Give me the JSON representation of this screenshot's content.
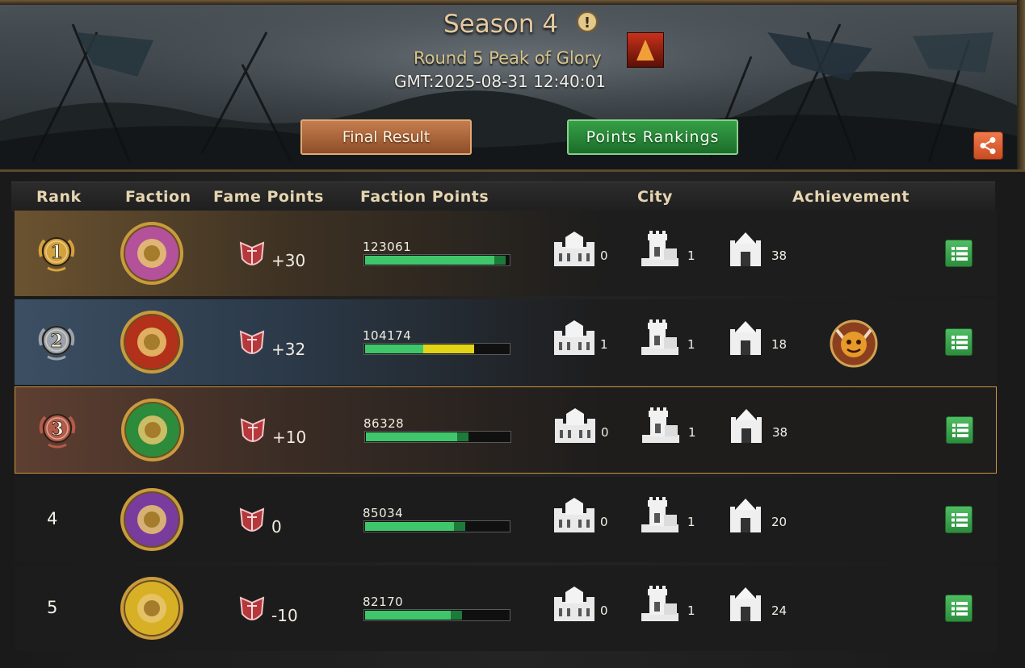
{
  "header": {
    "season_title": "Season 4",
    "round_title": "Round 5 Peak of Glory",
    "time_label": "GMT:2025-08-31 12:40:01",
    "tabs": [
      {
        "label": "Final Result",
        "color": "#a95f34"
      },
      {
        "label": "Points Rankings",
        "color": "#2a8a3a",
        "selected": true
      }
    ]
  },
  "table": {
    "columns": [
      "Rank",
      "Faction",
      "Fame Points",
      "Faction Points",
      "City",
      "Achievement"
    ],
    "rows": [
      {
        "rank": "1",
        "medal_color": "#d4a23c",
        "crest": "stag-crest",
        "crest_color": "#b3519a",
        "fame": "+30",
        "faction_points": "123061",
        "progress": [
          0.89
        ],
        "bar_colors": [
          "#3fc66a"
        ],
        "cities": [
          "0",
          "1",
          "38"
        ],
        "achievement": null
      },
      {
        "rank": "2",
        "medal_color": "#9aa3ad",
        "crest": "lion-crest",
        "crest_color": "#b3301b",
        "fame": "+32",
        "faction_points": "104174",
        "progress": [
          0.4,
          0.35
        ],
        "bar_colors": [
          "#3fc66a",
          "#e3d317"
        ],
        "cities": [
          "1",
          "1",
          "18"
        ],
        "achievement": "horned-beast-achievement-icon"
      },
      {
        "rank": "3",
        "medal_color": "#b45a4b",
        "crest": "rose-crest",
        "crest_color": "#2c8c3b",
        "fame": "+10",
        "faction_points": "86328",
        "progress": [
          0.63
        ],
        "bar_colors": [
          "#3fc66a"
        ],
        "cities": [
          "0",
          "1",
          "38"
        ],
        "achievement": null
      },
      {
        "rank": "4",
        "medal_color": null,
        "crest": "dragon-crest",
        "crest_color": "#7a3b9e",
        "fame": "0",
        "faction_points": "85034",
        "progress": [
          0.61
        ],
        "bar_colors": [
          "#3fc66a"
        ],
        "cities": [
          "0",
          "1",
          "20"
        ],
        "achievement": null
      },
      {
        "rank": "5",
        "medal_color": null,
        "crest": "wolf-crest",
        "crest_color": "#d8b025",
        "fame": "-10",
        "faction_points": "82170",
        "progress": [
          0.59
        ],
        "bar_colors": [
          "#3fc66a"
        ],
        "cities": [
          "0",
          "1",
          "24"
        ],
        "achievement": null
      }
    ]
  }
}
